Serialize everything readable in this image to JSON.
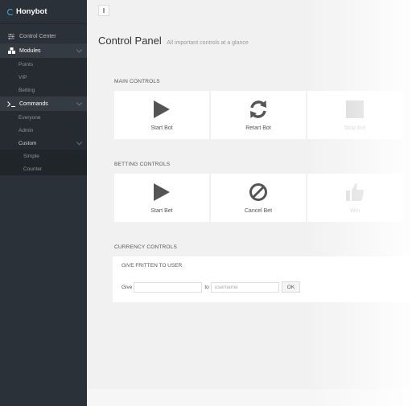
{
  "brand": {
    "name": "Honybot"
  },
  "sidebar": {
    "items": [
      {
        "label": "Control Center",
        "icon": "sliders-icon"
      },
      {
        "label": "Modules",
        "icon": "cubes-icon",
        "children": [
          "Points",
          "VIP",
          "Betting"
        ]
      },
      {
        "label": "Commands",
        "icon": "terminal-icon",
        "children": [
          {
            "label": "Everyone"
          },
          {
            "label": "Admin"
          },
          {
            "label": "Custom",
            "children": [
              "Simple",
              "Counter"
            ]
          }
        ]
      }
    ]
  },
  "topbar": {
    "toggle_label": "I"
  },
  "page": {
    "title": "Control Panel",
    "subtitle": "All important controls at a glance"
  },
  "main_controls": {
    "title": "MAIN CONTROLS",
    "cards": [
      {
        "label": "Start Bot",
        "icon": "play-icon",
        "enabled": true
      },
      {
        "label": "Retart Bot",
        "icon": "refresh-icon",
        "enabled": true
      },
      {
        "label": "Stop Bot",
        "icon": "stop-icon",
        "enabled": false
      }
    ]
  },
  "betting_controls": {
    "title": "BETTING CONTROLS",
    "cards": [
      {
        "label": "Start Bet",
        "icon": "play-icon",
        "enabled": true
      },
      {
        "label": "Cancel Bet",
        "icon": "ban-icon",
        "enabled": true
      },
      {
        "label": "Win",
        "icon": "thumbs-up-icon",
        "enabled": false
      }
    ]
  },
  "currency_controls": {
    "title": "CURRENCY CONTROLS",
    "panel_heading": "GIVE FRITTEN TO USER",
    "give_label": "Give",
    "amount_value": "",
    "to_label": "to",
    "username_placeholder": "username",
    "ok_label": "OK"
  },
  "colors": {
    "sidebar_bg": "#2b3138",
    "accent": "#4aa3df",
    "icon_gray": "#555555"
  }
}
